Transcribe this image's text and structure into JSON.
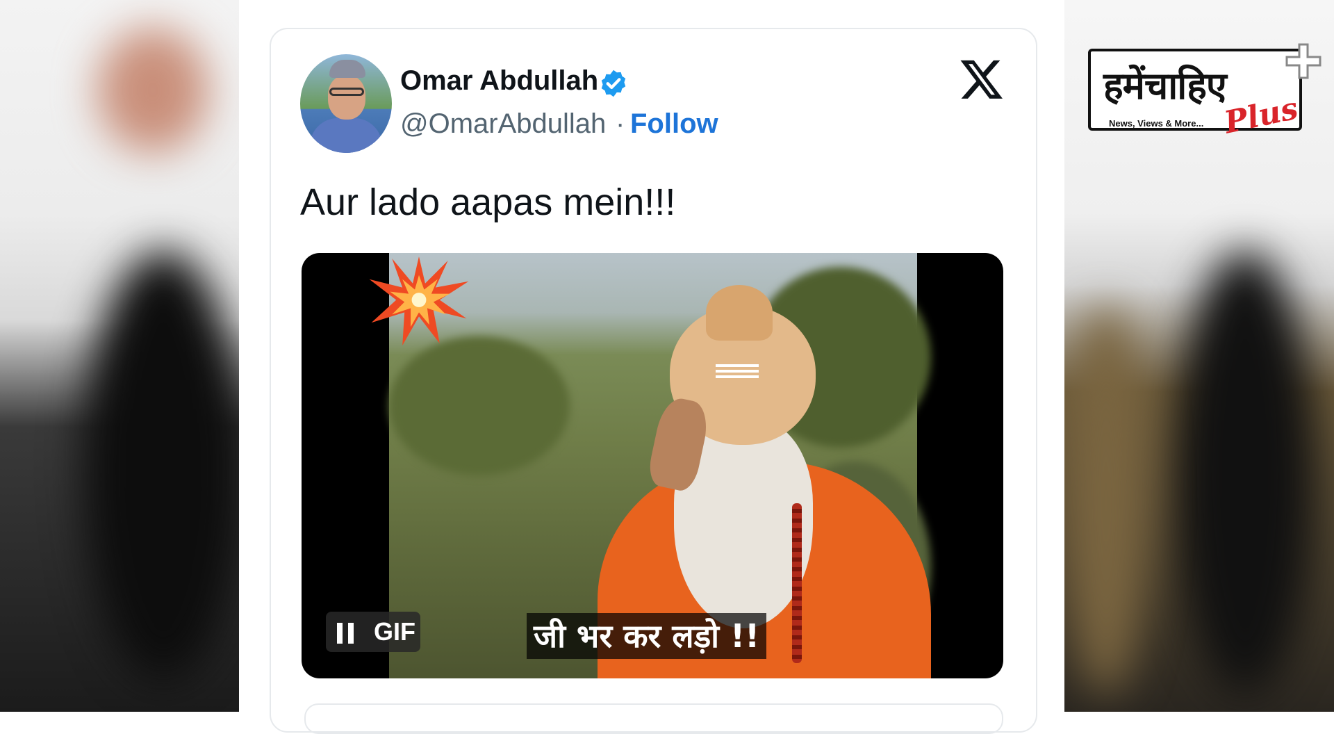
{
  "tweet": {
    "author_name": "Omar Abdullah",
    "handle": "@OmarAbdullah",
    "separator": "·",
    "follow_label": "Follow",
    "text": "Aur lado aapas mein!!!",
    "media": {
      "caption": "जी भर कर लड़ो !!",
      "gif_label": "GIF"
    }
  },
  "brand": {
    "name": "हमेंचाहिए",
    "tagline": "News, Views & More...",
    "suffix": "Plus"
  },
  "colors": {
    "follow": "#1d74d8",
    "verified": "#1d9bf0",
    "robe": "#e8631e",
    "brand_red": "#d9242a"
  },
  "icons": [
    "verified-badge-icon",
    "x-logo-icon",
    "pause-icon",
    "explosion-emoji-icon",
    "plus-cross-icon"
  ]
}
